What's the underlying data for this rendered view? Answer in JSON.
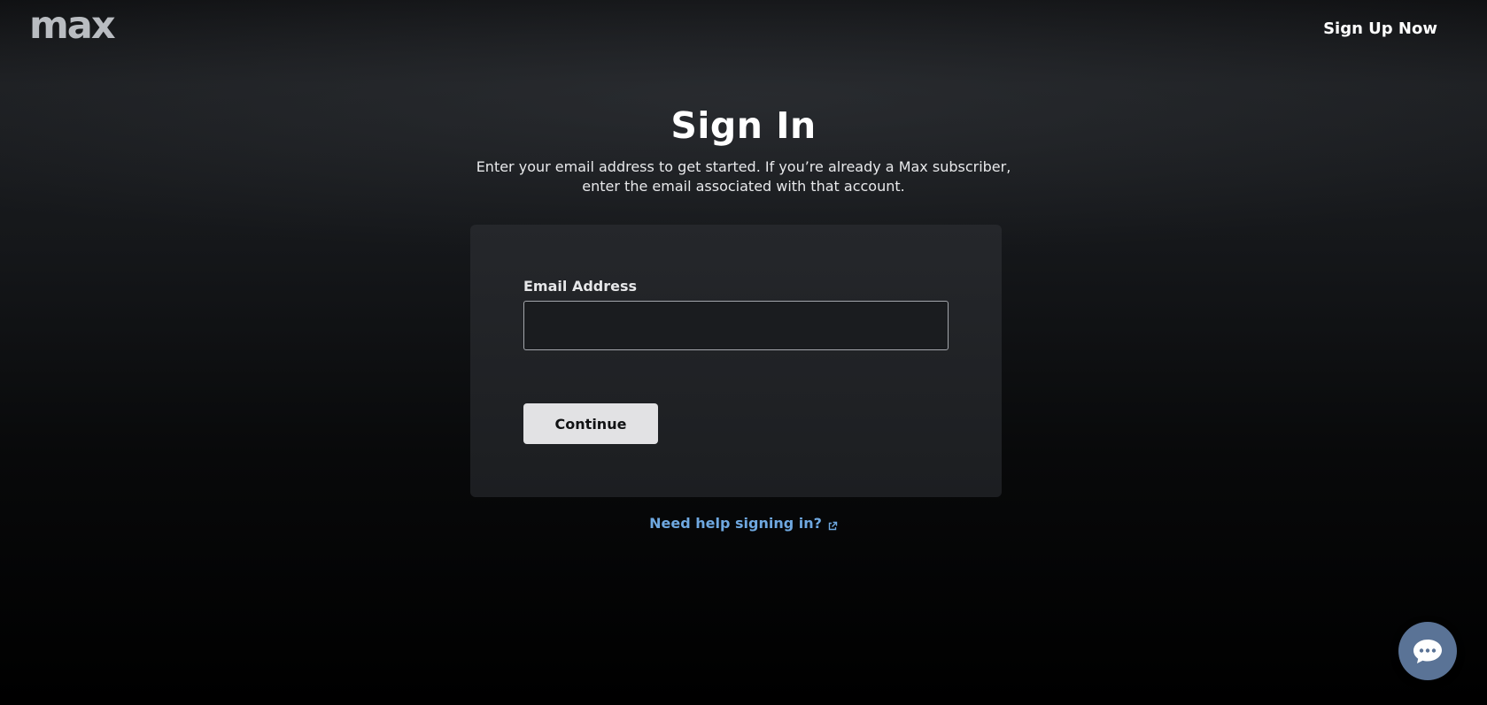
{
  "brand": {
    "logo_text": "max"
  },
  "header": {
    "signup_label": "Sign Up Now"
  },
  "main": {
    "title": "Sign In",
    "subtitle_line1": "Enter your email address to get started. If you’re already a Max subscriber,",
    "subtitle_line2": "enter the email associated with that account."
  },
  "form": {
    "email_label": "Email Address",
    "email_value": "",
    "email_placeholder": "",
    "continue_label": "Continue"
  },
  "help": {
    "label": "Need help signing in?",
    "icon": "external-link-icon"
  },
  "chat": {
    "icon": "chat-bubble-icon"
  },
  "colors": {
    "link": "#6fa8e0",
    "button_bg": "#e2e2e4",
    "chat_bg": "#5a7396",
    "card_bg": "#23252a"
  }
}
